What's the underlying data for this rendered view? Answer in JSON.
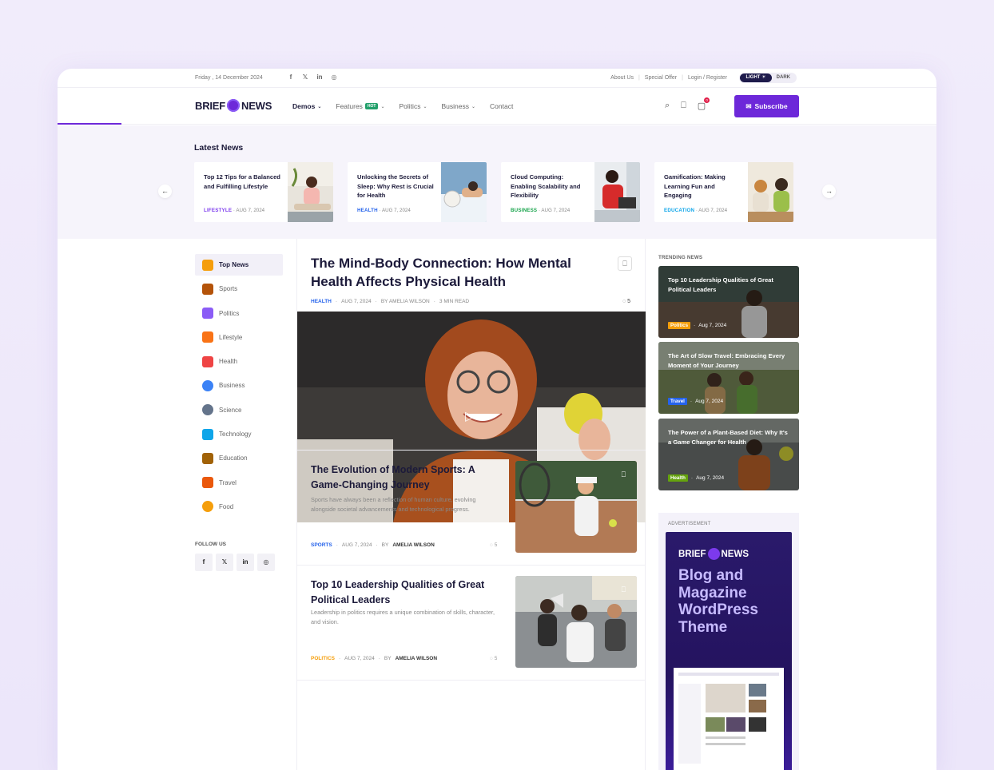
{
  "topbar": {
    "date": "Friday , 14 December 2024",
    "socials": [
      "f",
      "𝕏",
      "in",
      "◎"
    ],
    "links": [
      "About Us",
      "Special Offer",
      "Login / Register"
    ],
    "mode_light": "LIGHT ☀",
    "mode_dark": "DARK"
  },
  "header": {
    "logo_left": "BRIEF",
    "logo_right": "NEWS",
    "nav": [
      {
        "label": "Demos",
        "active": true
      },
      {
        "label": "Features",
        "hot": "HOT"
      },
      {
        "label": "Politics"
      },
      {
        "label": "Business"
      },
      {
        "label": "Contact"
      }
    ],
    "cart_count": "0",
    "subscribe": "Subscribe"
  },
  "latest": {
    "title": "Latest News",
    "prev": "←",
    "next": "→",
    "cards": [
      {
        "title": "Top 12 Tips for a Balanced and Fulfilling Lifestyle",
        "category": "LIFESTYLE",
        "date": "AUG 7, 2024",
        "color": "#7c3aed"
      },
      {
        "title": "Unlocking the Secrets of Sleep: Why Rest is Crucial for Health",
        "category": "HEALTH",
        "date": "AUG 7, 2024",
        "color": "#2563eb"
      },
      {
        "title": "Cloud Computing: Enabling Scalability and Flexibility",
        "category": "BUSINESS",
        "date": "AUG 7, 2024",
        "color": "#16a34a"
      },
      {
        "title": "Gamification: Making Learning Fun and Engaging",
        "category": "EDUCATION",
        "date": "AUG 7, 2024",
        "color": "#0ea5e9"
      }
    ]
  },
  "sidebar": {
    "items": [
      {
        "label": "Top News",
        "icon": "fire-icon",
        "color": "#f59e0b"
      },
      {
        "label": "Sports",
        "icon": "stadium-icon",
        "color": "#b45309"
      },
      {
        "label": "Politics",
        "icon": "ballot-box-icon",
        "color": "#8b5cf6"
      },
      {
        "label": "Lifestyle",
        "icon": "dumbbell-icon",
        "color": "#f97316"
      },
      {
        "label": "Health",
        "icon": "first-aid-icon",
        "color": "#ef4444"
      },
      {
        "label": "Business",
        "icon": "chart-icon",
        "color": "#3b82f6"
      },
      {
        "label": "Science",
        "icon": "molecule-icon",
        "color": "#64748b"
      },
      {
        "label": "Technology",
        "icon": "satellite-icon",
        "color": "#0ea5e9"
      },
      {
        "label": "Education",
        "icon": "books-icon",
        "color": "#a16207"
      },
      {
        "label": "Travel",
        "icon": "landmark-icon",
        "color": "#ea580c"
      },
      {
        "label": "Food",
        "icon": "burger-icon",
        "color": "#f59e0b"
      }
    ],
    "follow_label": "FOLLOW US",
    "follow_icons": [
      "f",
      "𝕏",
      "in",
      "◎"
    ]
  },
  "featured": {
    "title": "The Mind-Body Connection: How Mental Health Affects Physical Health",
    "category": "HEALTH",
    "date": "AUG 7, 2024",
    "author": "BY AMELIA WILSON",
    "read": "3 MIN READ",
    "comments": "5"
  },
  "articles": [
    {
      "title": "The Evolution of Modern Sports: A Game-Changing Journey",
      "desc": "Sports have always been a reflection of human culture, evolving alongside societal advancements and technological progress.",
      "category": "SPORTS",
      "category_color": "#2563eb",
      "date": "AUG 7, 2024",
      "by": "BY",
      "author": "AMELIA WILSON",
      "comments": "5"
    },
    {
      "title": "Top 10 Leadership Qualities of Great Political Leaders",
      "desc": "Leadership in politics requires a unique combination of skills, character, and vision.",
      "category": "POLITICS",
      "category_color": "#f59e0b",
      "date": "AUG 7, 2024",
      "by": "BY",
      "author": "AMELIA WILSON",
      "comments": "5"
    }
  ],
  "trending": {
    "label": "TRENDING NEWS",
    "items": [
      {
        "title": "Top 10 Leadership Qualities of Great Political Leaders",
        "category": "Politics",
        "date": "Aug 7, 2024",
        "color": "#f59e0b"
      },
      {
        "title": "The Art of Slow Travel: Embracing Every Moment of Your Journey",
        "category": "Travel",
        "date": "Aug 7, 2024",
        "color": "#2563eb"
      },
      {
        "title": "The Power of a Plant-Based Diet: Why It's a Game Changer for Health",
        "category": "Health",
        "date": "Aug 7, 2024",
        "color": "#65a30d"
      }
    ]
  },
  "ad": {
    "label": "ADVERTISEMENT",
    "brand_left": "BRIEF",
    "brand_right": "NEWS",
    "headline": "Blog and Magazine WordPress Theme"
  }
}
